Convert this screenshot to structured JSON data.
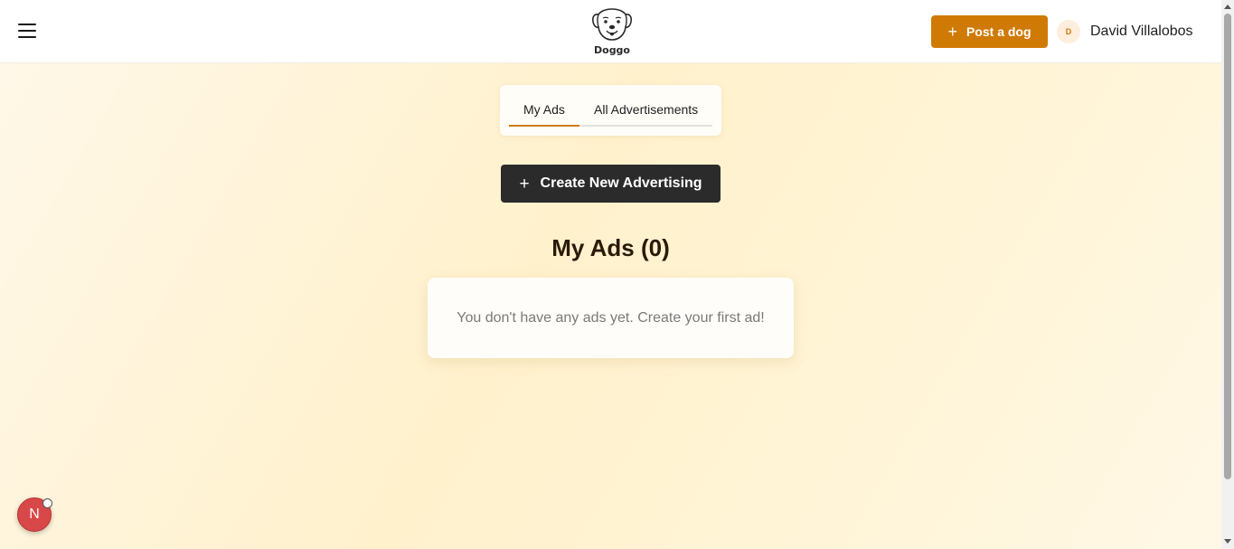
{
  "header": {
    "logo_text": "Doggo",
    "post_button_label": "Post a dog",
    "user": {
      "avatar_initial": "D",
      "name": "David Villalobos"
    }
  },
  "tabs": [
    {
      "label": "My Ads",
      "active": true
    },
    {
      "label": "All Advertisements",
      "active": false
    }
  ],
  "create_button_label": "Create New Advertising",
  "section_title": "My Ads (0)",
  "empty_message": "You don't have any ads yet. Create your first ad!",
  "fab": {
    "label": "N"
  },
  "colors": {
    "accent": "#d07a06",
    "dark_button": "#2b2b2b",
    "fab": "#d94848"
  },
  "icons": {
    "menu": "hamburger-icon",
    "logo": "dog-face-icon",
    "plus": "plus-icon"
  }
}
